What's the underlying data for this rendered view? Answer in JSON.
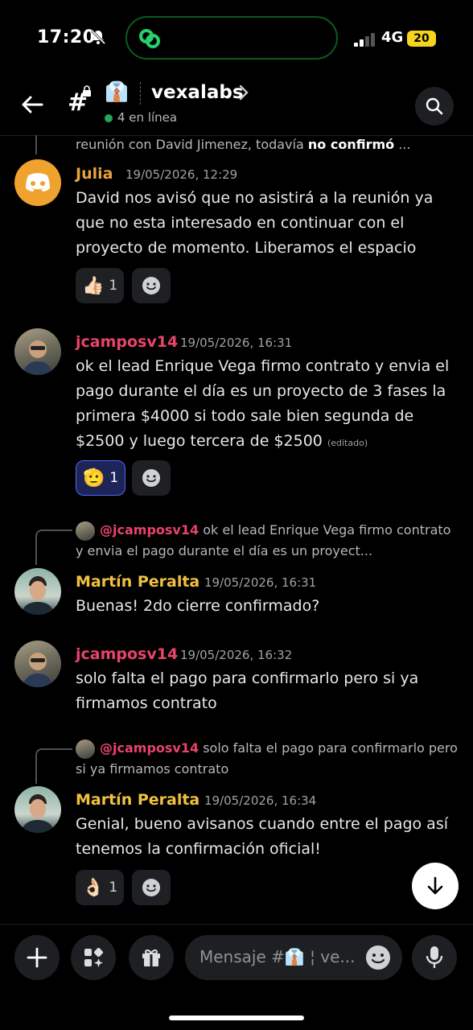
{
  "status_bar": {
    "time": "17:20",
    "network": "4G",
    "battery": "20"
  },
  "header": {
    "channel_emoji": "👔",
    "channel_name": "vexalabs",
    "online_count": "4 en línea"
  },
  "context_line": {
    "text": "reunión con David Jimenez, todavía ",
    "bold": "no confirmó",
    "tail": " ..."
  },
  "messages": [
    {
      "author": "Julia",
      "timestamp": "19/05/2026, 12:29",
      "text": "David nos avisó que no asistirá a la reunión ya que no esta interesado en continuar con el proyecto de momento. Liberamos el espacio",
      "reaction": {
        "emoji": "👍🏻",
        "count": "1"
      }
    },
    {
      "author": "jcamposv14",
      "timestamp": "19/05/2026, 16:31",
      "text": "ok el lead Enrique Vega firmo contrato y envia el pago durante el día es un proyecto de 3 fases la primera $4000 si todo sale bien segunda de $2500 y luego tercera de $2500",
      "edited": "(editado)",
      "reaction": {
        "emoji": "🫡",
        "count": "1"
      }
    },
    {
      "reply": {
        "mention": "@jcamposv14",
        "text": "ok el lead Enrique Vega firmo contrato y envia el pago durante el día es un proyect..."
      },
      "author": "Martín Peralta",
      "timestamp": "19/05/2026, 16:31",
      "text": "Buenas! 2do cierre confirmado?"
    },
    {
      "author": "jcamposv14",
      "timestamp": "19/05/2026, 16:32",
      "text": "solo falta el pago para confirmarlo pero si ya firmamos contrato"
    },
    {
      "reply": {
        "mention": "@jcamposv14",
        "text": "solo falta el pago para confirmarlo pero si ya firmamos contrato"
      },
      "author": "Martín Peralta",
      "timestamp": "19/05/2026, 16:34",
      "text": "Genial, bueno avisanos cuando entre el pago así tenemos la confirmación oficial!",
      "reaction": {
        "emoji": "👌🏻",
        "count": "1"
      }
    }
  ],
  "composer": {
    "placeholder": "Mensaje #👔 ¦ ve..."
  },
  "colors": {
    "julia": "#e8a33d",
    "jcampos": "#e8446a",
    "martin": "#f0c040",
    "online": "#23a55a",
    "accent": "#5865f2"
  }
}
